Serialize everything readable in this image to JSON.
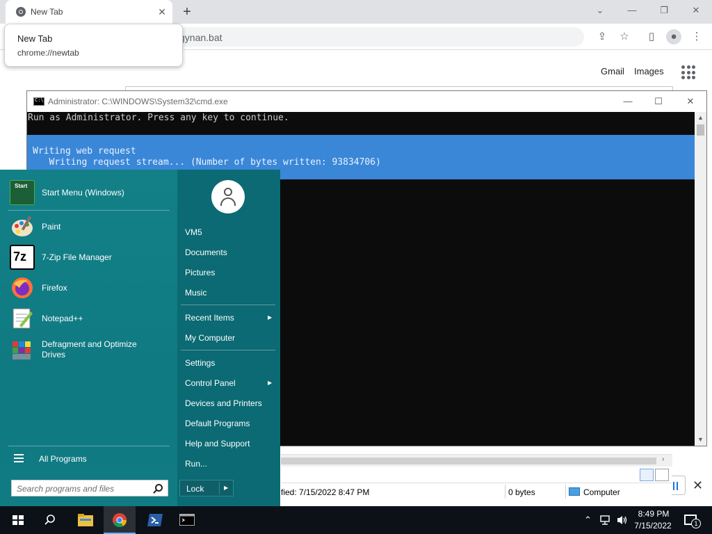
{
  "browser": {
    "tab_title": "New Tab",
    "address_text": "gynan.bat",
    "hover_card": {
      "title": "New Tab",
      "url": "chrome://newtab"
    },
    "links": {
      "gmail": "Gmail",
      "images": "Images"
    }
  },
  "cmd": {
    "title": "Administrator: C:\\WINDOWS\\System32\\cmd.exe",
    "line1": "Run as Administrator. Press any key to continue.",
    "progress_title": "Writing web request",
    "progress_detail": "   Writing request stream... (Number of bytes written: 93834706)"
  },
  "explorer": {
    "modified": "fied: 7/15/2022 8:47 PM",
    "size": "0 bytes",
    "location": "Computer"
  },
  "start_menu": {
    "programs": [
      {
        "label": "Start Menu (Windows)"
      },
      {
        "label": "Paint"
      },
      {
        "label": "7-Zip File Manager"
      },
      {
        "label": "Firefox"
      },
      {
        "label": "Notepad++"
      },
      {
        "label": "Defragment and Optimize Drives"
      }
    ],
    "start_icon_text": "Start",
    "sevenzip_icon_text": "7z",
    "all_programs": "All Programs",
    "search_placeholder": "Search programs and files",
    "right_items": {
      "user": "VM5",
      "documents": "Documents",
      "pictures": "Pictures",
      "music": "Music",
      "recent": "Recent Items",
      "computer": "My Computer",
      "settings": "Settings",
      "control_panel": "Control Panel",
      "devices": "Devices and Printers",
      "defaults": "Default Programs",
      "help": "Help and Support",
      "run": "Run..."
    },
    "lock": "Lock"
  },
  "taskbar": {
    "time": "8:49 PM",
    "date": "7/15/2022",
    "notification_count": "1",
    "apps": [
      "file-explorer-icon",
      "chrome-icon",
      "powershell-icon",
      "cmd-icon"
    ]
  }
}
